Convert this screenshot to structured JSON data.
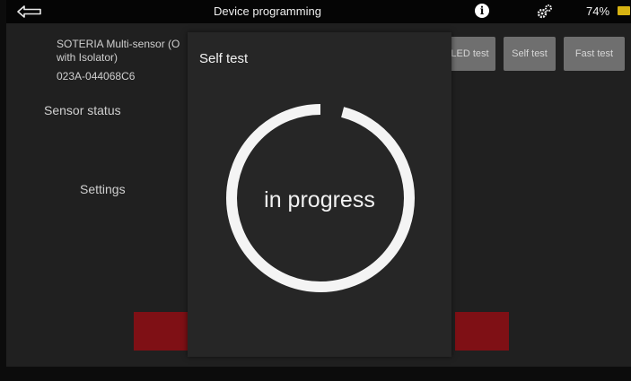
{
  "topbar": {
    "title": "Device programming",
    "battery": "74%",
    "icons": {
      "back": "back-arrow-icon",
      "info": "info-icon",
      "settings": "gears-icon",
      "battery": "battery-icon"
    },
    "battery_color": "#d7b312"
  },
  "device": {
    "name_line1": "SOTERIA Multi-sensor (O",
    "name_line2": "with Isolator)",
    "id": "023A-044068C6"
  },
  "sections": {
    "sensor_status": "Sensor status",
    "settings": "Settings"
  },
  "buttons": {
    "led_test": "LED test",
    "self_test": "Self test",
    "fast_test": "Fast test"
  },
  "modal": {
    "title": "Self test",
    "status": "in progress",
    "progress_percent": 96
  },
  "colors": {
    "accent_red": "#7f1015",
    "button_grey": "#6f6f6f"
  }
}
